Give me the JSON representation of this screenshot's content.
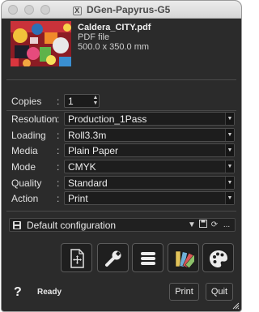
{
  "window": {
    "title": "DGen-Papyrus-G5",
    "logo_glyph": "X"
  },
  "file": {
    "name": "Caldera_CITY.pdf",
    "type": "PDF file",
    "size": "500.0 x 350.0 mm"
  },
  "settings": {
    "copies": {
      "label": "Copies",
      "value": "1"
    },
    "rows": [
      {
        "label": "Resolution",
        "value": "Production_1Pass"
      },
      {
        "label": "Loading",
        "value": "Roll3.3m"
      },
      {
        "label": "Media",
        "value": "Plain Paper"
      },
      {
        "label": "Mode",
        "value": "CMYK"
      },
      {
        "label": "Quality",
        "value": "Standard"
      },
      {
        "label": "Action",
        "value": "Print"
      }
    ],
    "separator": ":"
  },
  "configuration": {
    "label": "Default configuration",
    "more_label": "..."
  },
  "toolbar": [
    "page-move-icon",
    "wrench-icon",
    "list-icon",
    "swatch-icon",
    "palette-icon"
  ],
  "footer": {
    "help": "?",
    "status": "Ready",
    "print_label": "Print",
    "quit_label": "Quit"
  },
  "colors": {
    "window_bg": "#2b2b2b",
    "field_bg": "#1d1d1d",
    "titlebar": "#e0e0e0"
  }
}
